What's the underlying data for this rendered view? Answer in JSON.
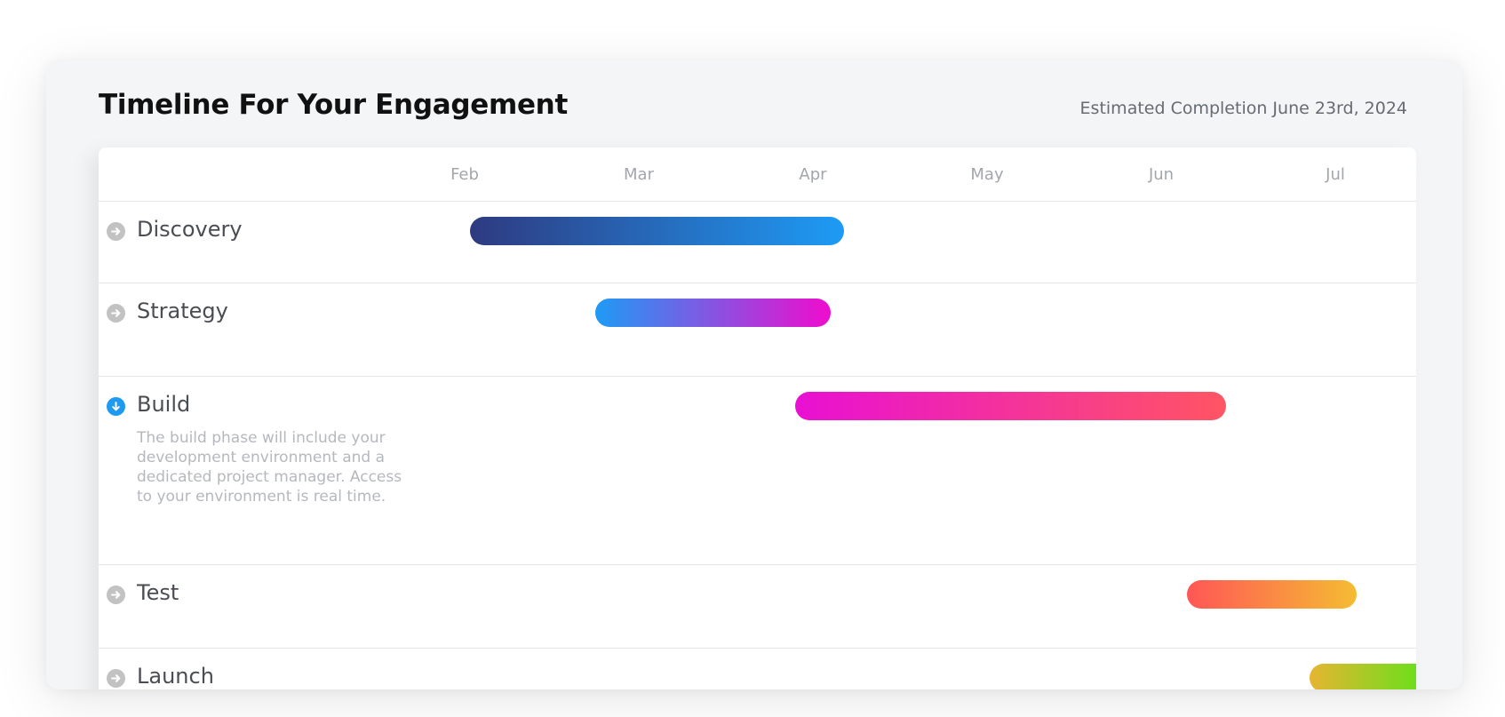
{
  "header": {
    "title": "Timeline For Your Engagement",
    "estimated_completion": "Estimated Completion June 23rd, 2024"
  },
  "months": [
    "Feb",
    "Mar",
    "Apr",
    "May",
    "Jun",
    "Jul"
  ],
  "phases": [
    {
      "label": "Discovery",
      "expanded": false,
      "description": "",
      "start_month": 0.03,
      "end_month": 2.18,
      "gradient": [
        "#2e3a80",
        "#1e9bf5"
      ]
    },
    {
      "label": "Strategy",
      "expanded": false,
      "description": "",
      "start_month": 0.75,
      "end_month": 2.1,
      "gradient": [
        "#1e9bf5",
        "#f00ccd"
      ]
    },
    {
      "label": "Build",
      "expanded": true,
      "description": "The build phase will include your development environment and a dedicated project manager. Access to your environment is real time.",
      "start_month": 1.9,
      "end_month": 4.37,
      "gradient": [
        "#e810d3",
        "#ff5563"
      ]
    },
    {
      "label": "Test",
      "expanded": false,
      "description": "",
      "start_month": 4.15,
      "end_month": 5.12,
      "gradient": [
        "#ff5656",
        "#f5bc32"
      ]
    },
    {
      "label": "Launch",
      "expanded": false,
      "description": "",
      "start_month": 4.85,
      "end_month": 5.8,
      "gradient": [
        "#e6b532",
        "#2cf510"
      ]
    }
  ]
}
